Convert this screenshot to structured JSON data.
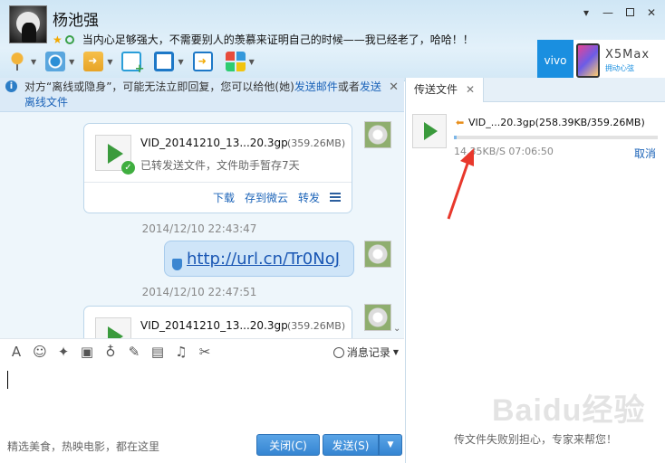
{
  "window": {
    "contact_name": "杨池强",
    "status_text": "当内心足够强大，不需要别人的羡慕来证明自己的时候——我已经老了，哈哈！！",
    "controls": {
      "settings": "▾",
      "minimize": "—",
      "close": "✕"
    }
  },
  "ad": {
    "brand": "vivo",
    "model": "X5Max",
    "slogan": "拥动心弦"
  },
  "notice": {
    "part1": "对方“离线或隐身”，可能无法立即回复，您可以给他(她)",
    "link1": "发送邮件",
    "part2": "或者",
    "link2": "发送离线文件"
  },
  "messages": {
    "file1": {
      "name": "VID_20141210_13...20.3gp",
      "size": "(359.26MB)",
      "status": "已转发送文件，文件助手暂存7天",
      "actions": {
        "download": "下载",
        "save_cloud": "存到微云",
        "forward": "转发"
      }
    },
    "timestamp1": "2014/12/10 22:43:47",
    "url": "http://url.cn/Tr0NoJ",
    "timestamp2": "2014/12/10 22:47:51",
    "file2": {
      "name": "VID_20141210_13...20.3gp",
      "size": "(359.26MB)"
    }
  },
  "input_toolbar": {
    "history_label": "消息记录"
  },
  "bottom": {
    "hint": "精选美食，热映电影，都在这里",
    "close_label": "关闭(C)",
    "send_label": "发送(S)"
  },
  "side_panel": {
    "tab_label": "传送文件",
    "transfer": {
      "name": "VID_...20.3gp(258.39KB/359.26MB)",
      "progress_fraction": 0.0007,
      "speed": "14.35KB/S 07:06:50",
      "cancel_label": "取消"
    },
    "help_text": "传文件失败别担心，专家来帮您！"
  },
  "watermark": "Baidu经验",
  "colors": {
    "accent": "#3585d2",
    "link": "#1b63b8",
    "play": "#3a9a3c",
    "arrow": "#e8382c"
  }
}
